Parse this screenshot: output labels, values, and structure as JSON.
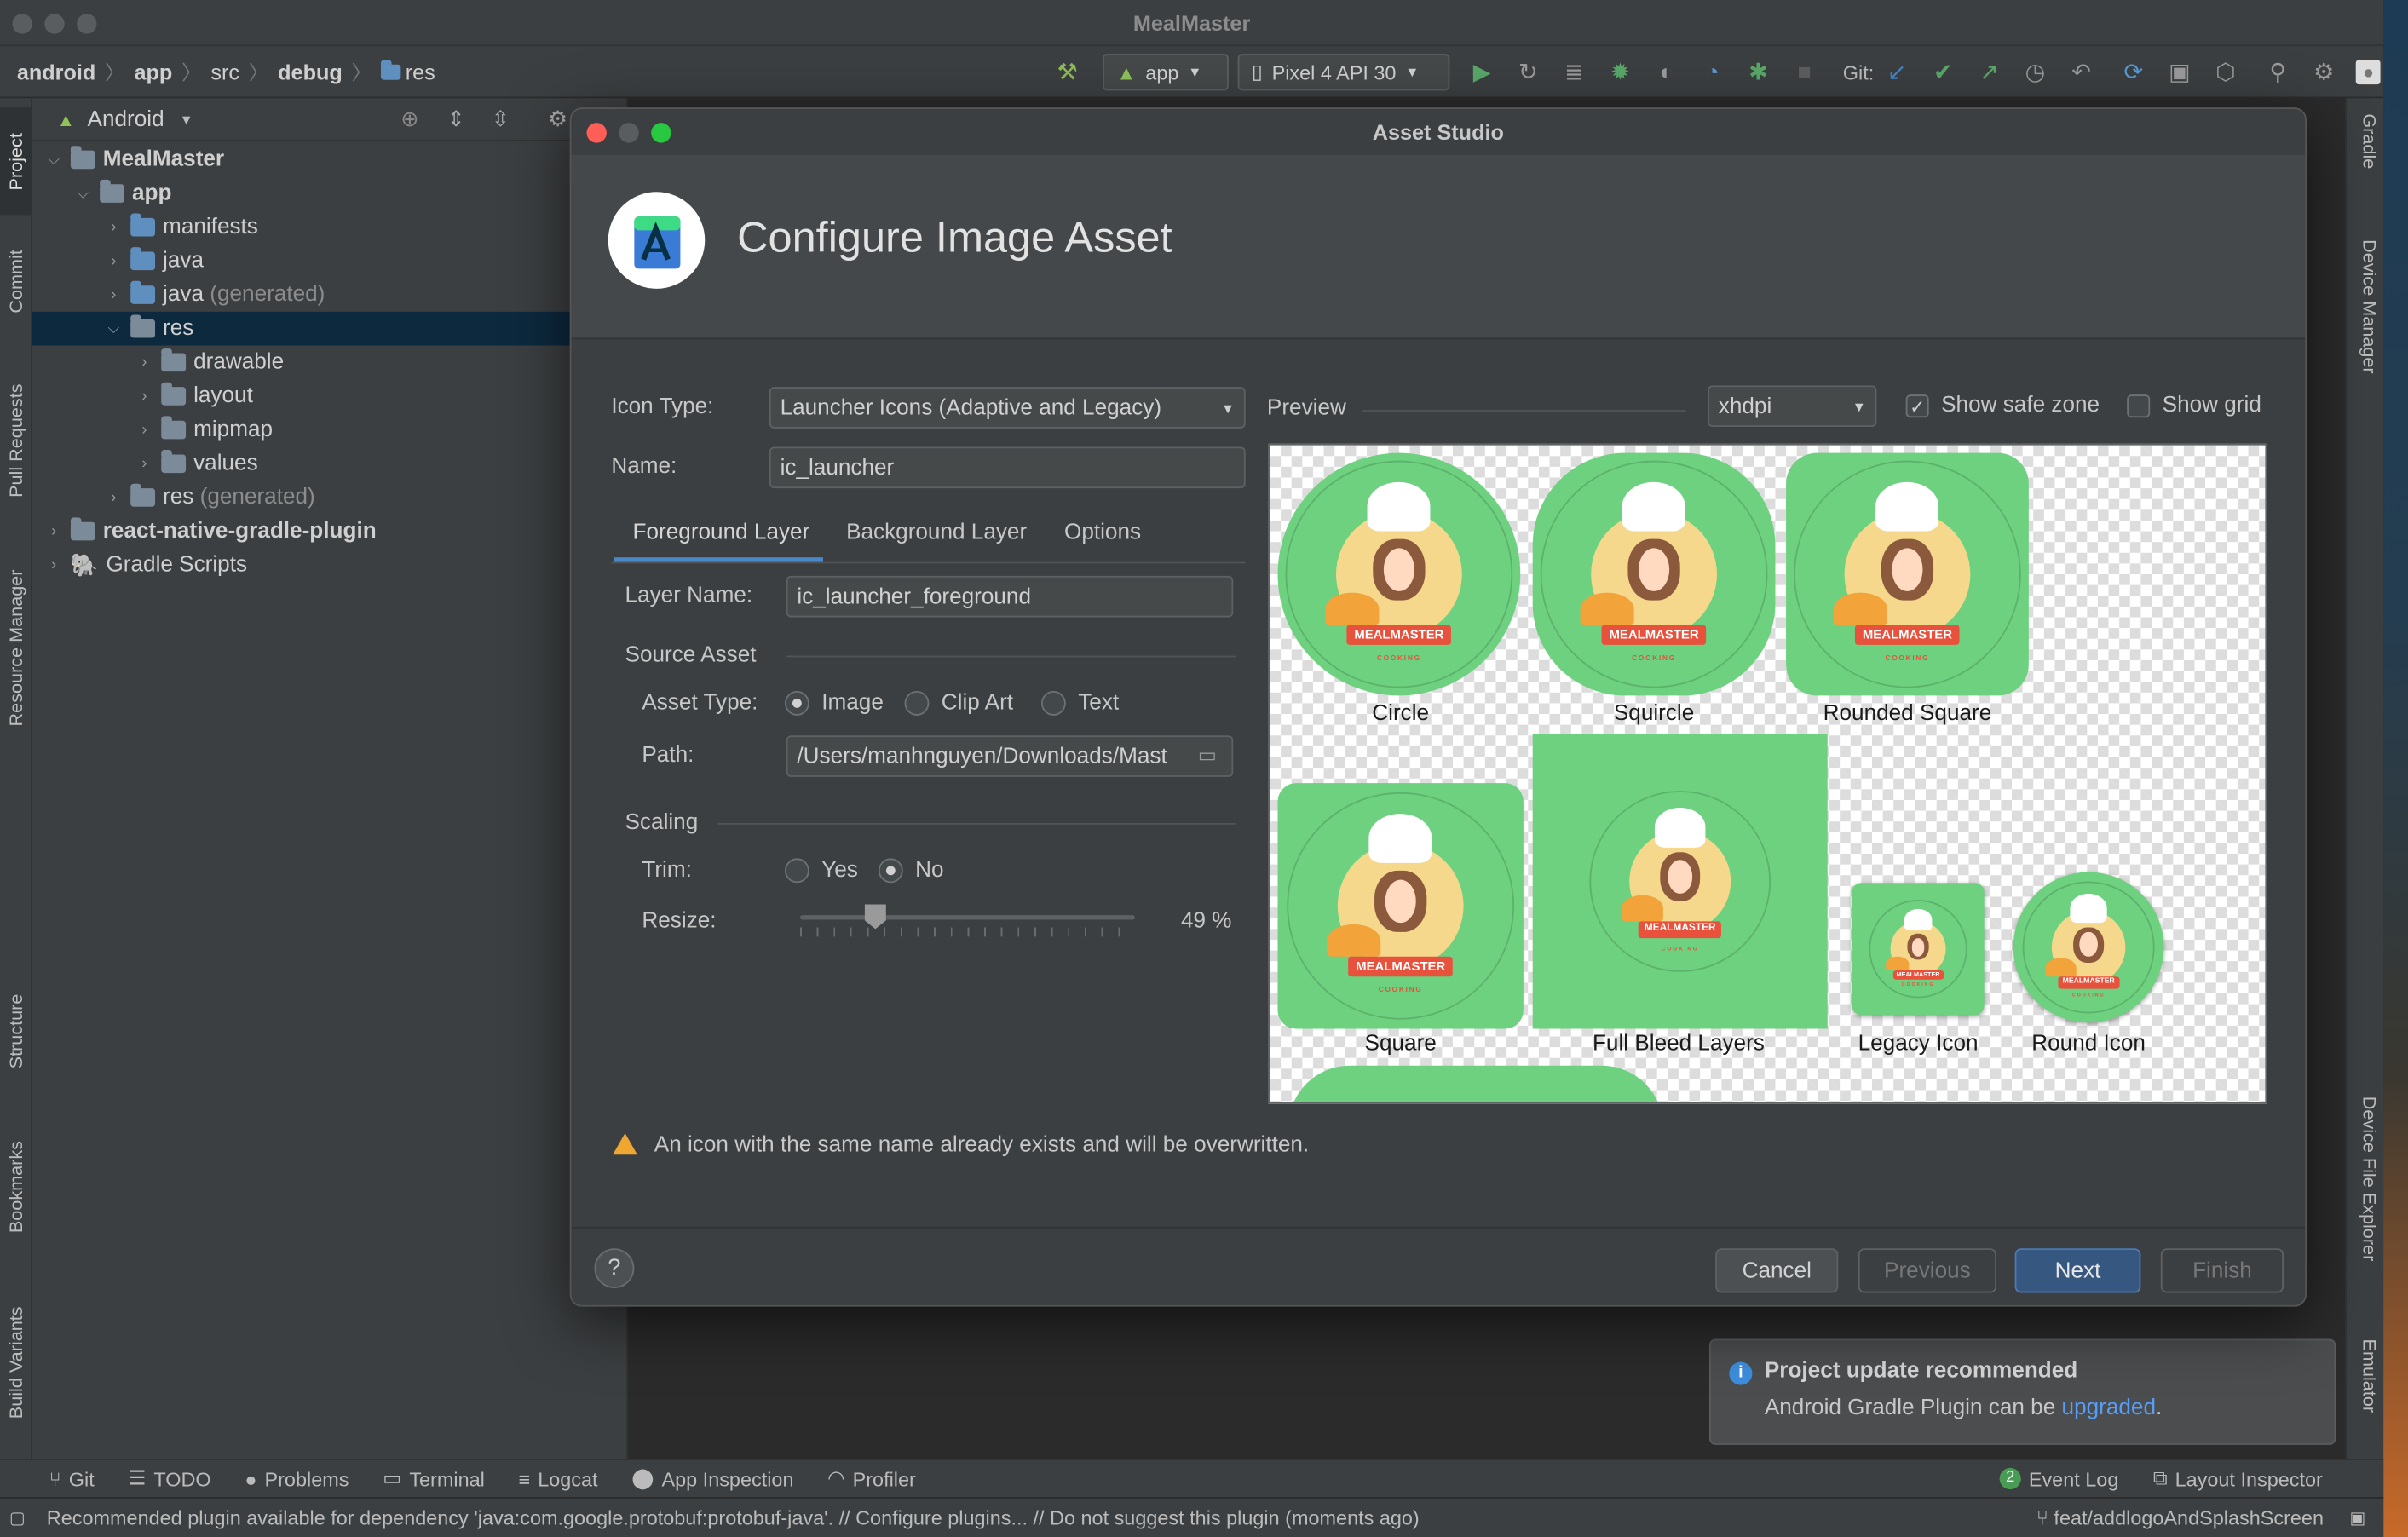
{
  "window": {
    "title": "MealMaster"
  },
  "breadcrumbs": [
    "android",
    "app",
    "src",
    "debug",
    "res"
  ],
  "toolbar": {
    "config": "app",
    "device": "Pixel 4 API 30",
    "git_label": "Git:"
  },
  "project_panel": {
    "view": "Android",
    "tree": [
      {
        "label": "MealMaster",
        "extra": ""
      },
      {
        "label": "app",
        "extra": ""
      },
      {
        "label": "manifests",
        "extra": ""
      },
      {
        "label": "java",
        "extra": ""
      },
      {
        "label": "java",
        "extra": "(generated)"
      },
      {
        "label": "res",
        "extra": ""
      },
      {
        "label": "drawable",
        "extra": ""
      },
      {
        "label": "layout",
        "extra": ""
      },
      {
        "label": "mipmap",
        "extra": ""
      },
      {
        "label": "values",
        "extra": ""
      },
      {
        "label": "res",
        "extra": "(generated)"
      },
      {
        "label": "react-native-gradle-plugin",
        "extra": ""
      },
      {
        "label": "Gradle Scripts",
        "extra": ""
      }
    ]
  },
  "left_tabs": [
    "Project",
    "Commit",
    "Pull Requests",
    "Resource Manager",
    "Structure",
    "Bookmarks",
    "Build Variants"
  ],
  "right_tabs": [
    "Gradle",
    "Device Manager",
    "Device File Explorer",
    "Emulator"
  ],
  "dialog": {
    "title": "Asset Studio",
    "heading": "Configure Image Asset",
    "icon_type_label": "Icon Type:",
    "icon_type_value": "Launcher Icons (Adaptive and Legacy)",
    "name_label": "Name:",
    "name_value": "ic_launcher",
    "tabs": [
      "Foreground Layer",
      "Background Layer",
      "Options"
    ],
    "layer_name_label": "Layer Name:",
    "layer_name_value": "ic_launcher_foreground",
    "source_asset_label": "Source Asset",
    "asset_type_label": "Asset Type:",
    "asset_types": [
      "Image",
      "Clip Art",
      "Text"
    ],
    "path_label": "Path:",
    "path_value": "/Users/manhnguyen/Downloads/Mast",
    "scaling_label": "Scaling",
    "trim_label": "Trim:",
    "trim_options": [
      "Yes",
      "No"
    ],
    "resize_label": "Resize:",
    "resize_value": "49 %",
    "resize_fraction": 0.49,
    "preview_label": "Preview",
    "density": "xhdpi",
    "show_safe_zone": "Show safe zone",
    "show_grid": "Show grid",
    "preview_items": [
      "Circle",
      "Squircle",
      "Rounded Square",
      "Square",
      "Full Bleed Layers",
      "Legacy Icon",
      "Round Icon"
    ],
    "logo_text": "MEALMASTER",
    "logo_sub": "COOKING",
    "warning": "An icon with the same name already exists and will be overwritten.",
    "buttons": {
      "help": "?",
      "cancel": "Cancel",
      "previous": "Previous",
      "next": "Next",
      "finish": "Finish"
    }
  },
  "notification": {
    "title": "Project update recommended",
    "text": "Android Gradle Plugin can be ",
    "link": "upgraded",
    "end": "."
  },
  "bottom_tabs": [
    "Git",
    "TODO",
    "Problems",
    "Terminal",
    "Logcat",
    "App Inspection",
    "Profiler"
  ],
  "bottom_right": {
    "event_log_count": "2",
    "event_log": "Event Log",
    "layout_inspector": "Layout Inspector"
  },
  "status": {
    "message": "Recommended plugin available for dependency 'java:com.google.protobuf:protobuf-java'. // Configure plugins... // Do not suggest this plugin (moments ago)",
    "branch": "feat/addlogoAndSplashScreen"
  },
  "colors": {
    "accent": "#365880",
    "icon_green": "#6dd17f",
    "banner_red": "#e8513c",
    "warning": "#f0a732",
    "link": "#589df6"
  }
}
